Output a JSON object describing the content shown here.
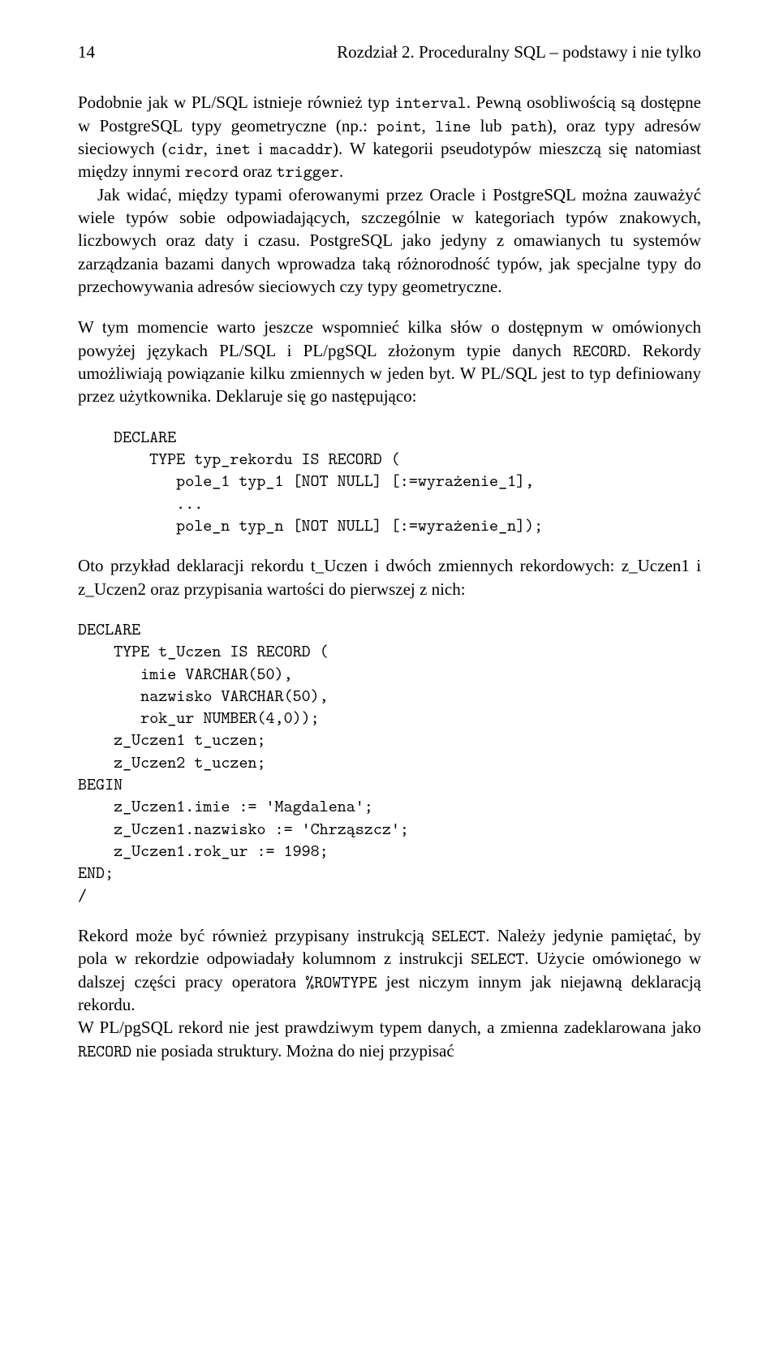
{
  "header": {
    "page_number": "14",
    "running_title": "Rozdział 2. Proceduralny SQL – podstawy i nie tylko"
  },
  "p1_a": "Podobnie jak w PL/SQL istnieje również typ ",
  "p1_code1": "interval",
  "p1_b": ". Pewną osobliwością są dostępne w PostgreSQL typy geometryczne (np.: ",
  "p1_code2": "point",
  "p1_c": ", ",
  "p1_code3": "line",
  "p1_d": " lub ",
  "p1_code4": "path",
  "p1_e": "), oraz typy adresów sieciowych (",
  "p1_code5": "cidr",
  "p1_f": ", ",
  "p1_code6": "inet",
  "p1_g": " i ",
  "p1_code7": "macaddr",
  "p1_h": "). W kategorii pseudo­typów mieszczą się natomiast między innymi ",
  "p1_code8": "record",
  "p1_i": " oraz ",
  "p1_code9": "trigger",
  "p1_j": ".",
  "p2": "Jak widać, między typami oferowanymi przez Oracle i PostgreSQL moż­na zauważyć wiele typów sobie odpowiadających, szczególnie w kategoriach typów znakowych, liczbowych oraz daty i czasu. PostgreSQL jako jedyny z omawianych tu systemów zarządzania bazami danych wprowadza taką różnorodność typów, jak specjalne typy do przechowywania adresów siecio­wych czy typy geometryczne.",
  "p3_a": "W tym momencie warto jeszcze wspomnieć kilka słów o dostępnym w omó­wionych powyżej językach PL/SQL i PL/pgSQL złożonym typie danych ",
  "p3_code1": "RECORD",
  "p3_b": ". Rekordy umożliwiają powiązanie kilku zmiennych w jeden byt. W PL/SQL jest to typ definiowany przez użytkownika. Deklaruje się go następująco:",
  "code1": "DECLARE\n    TYPE typ_rekordu IS RECORD (\n       pole_1 typ_1 [NOT NULL] [:=wyrażenie_1],\n       ...\n       pole_n typ_n [NOT NULL] [:=wyrażenie_n]);",
  "p4_a": "Oto przykład deklaracji rekordu t",
  "p4_us1": "_",
  "p4_b": "Uczen i dwóch zmiennych rekordowych: z",
  "p4_us2": "_",
  "p4_c": "Uczen1 i z",
  "p4_us3": "_",
  "p4_d": "Uczen2 oraz przypisania wartości do pierwszej z nich:",
  "code2": "DECLARE\n    TYPE t_Uczen IS RECORD (\n       imie VARCHAR(50),\n       nazwisko VARCHAR(50),\n       rok_ur NUMBER(4,0));\n    z_Uczen1 t_uczen;\n    z_Uczen2 t_uczen;\nBEGIN\n    z_Uczen1.imie := 'Magdalena';\n    z_Uczen1.nazwisko := 'Chrząszcz';\n    z_Uczen1.rok_ur := 1998;\nEND;\n/",
  "p5_a": "Rekord może być również przypisany instrukcją ",
  "p5_code1": "SELECT",
  "p5_b": ". Należy jedynie pa­miętać, by pola w rekordzie odpowiadały kolumnom z instrukcji ",
  "p5_code2": "SELECT",
  "p5_c": ". Użycie omówionego w dalszej części pracy operatora ",
  "p5_code3": "%ROWTYPE",
  "p5_d": " jest niczym innym jak niejawną deklaracją rekordu.",
  "p6_a": "W PL/pgSQL rekord nie jest prawdziwym typem danych, a zmienna za­deklarowana jako ",
  "p6_code1": "RECORD",
  "p6_b": " nie posiada struktury. Można do niej przypisać"
}
